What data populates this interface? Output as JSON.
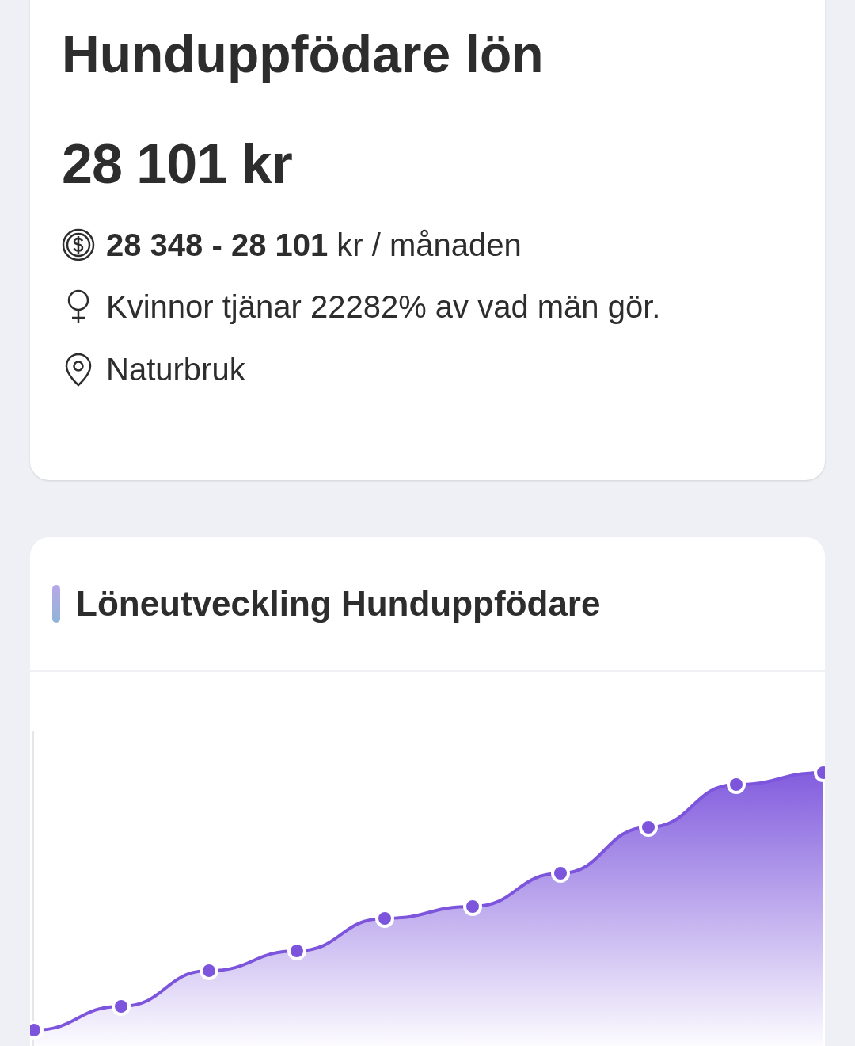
{
  "salary_card": {
    "title": "Hunduppfödare lön",
    "amount": "28 101 kr",
    "details": [
      {
        "kind": "range",
        "text": "**28 348 - 28 101** kr / månaden"
      },
      {
        "kind": "gender",
        "text": "Kvinnor tjänar 22282% av vad män gör."
      },
      {
        "kind": "location",
        "text": "Naturbruk"
      }
    ]
  },
  "trend_card": {
    "title": "Löneutveckling Hunduppfödare"
  }
}
